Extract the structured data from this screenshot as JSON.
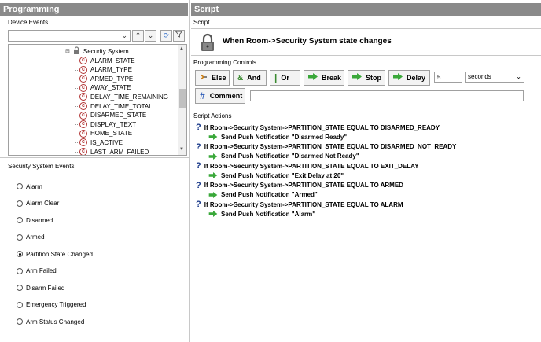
{
  "left": {
    "header": "Programming",
    "device_events_label": "Device Events",
    "tree": {
      "root": "Security System",
      "items": [
        "ALARM_STATE",
        "ALARM_TYPE",
        "ARMED_TYPE",
        "AWAY_STATE",
        "DELAY_TIME_REMAINING",
        "DELAY_TIME_TOTAL",
        "DISARMED_STATE",
        "DISPLAY_TEXT",
        "HOME_STATE",
        "IS_ACTIVE",
        "LAST_ARM_FAILED"
      ]
    },
    "events_label": "Security System Events",
    "events": [
      {
        "label": "Alarm",
        "checked": false
      },
      {
        "label": "Alarm Clear",
        "checked": false
      },
      {
        "label": "Disarmed",
        "checked": false
      },
      {
        "label": "Armed",
        "checked": false
      },
      {
        "label": "Partition State Changed",
        "checked": true
      },
      {
        "label": "Arm Failed",
        "checked": false
      },
      {
        "label": "Disarm Failed",
        "checked": false
      },
      {
        "label": "Emergency Triggered",
        "checked": false
      },
      {
        "label": "Arm Status Changed",
        "checked": false
      }
    ]
  },
  "right": {
    "header": "Script",
    "script_label": "Script",
    "trigger_title": "When Room->Security System state changes",
    "controls_label": "Programming Controls",
    "controls": {
      "else": "Else",
      "and": "And",
      "or": "Or",
      "break": "Break",
      "stop": "Stop",
      "delay": "Delay",
      "delay_value": "5",
      "delay_unit": "seconds",
      "comment": "Comment"
    },
    "actions_label": "Script Actions",
    "actions": [
      {
        "condition": "If Room->Security System->PARTITION_STATE EQUAL TO DISARMED_READY",
        "then": "Send Push Notification \"Disarmed Ready\""
      },
      {
        "condition": "If Room->Security System->PARTITION_STATE EQUAL TO DISARMED_NOT_READY",
        "then": "Send Push Notification \"Disarmed Not Ready\""
      },
      {
        "condition": "If Room->Security System->PARTITION_STATE EQUAL TO EXIT_DELAY",
        "then": "Send Push Notification \"Exit Delay at 20\""
      },
      {
        "condition": "If Room->Security System->PARTITION_STATE EQUAL TO ARMED",
        "then": "Send Push Notification \"Armed\""
      },
      {
        "condition": "If Room->Security System->PARTITION_STATE EQUAL TO ALARM",
        "then": "Send Push Notification \"Alarm\""
      }
    ]
  },
  "colors": {
    "header_bg": "#8a8a8a",
    "green_arrow": "#3aa83a",
    "qmark": "#1a3a8a",
    "tree_icon": "#b03030"
  }
}
